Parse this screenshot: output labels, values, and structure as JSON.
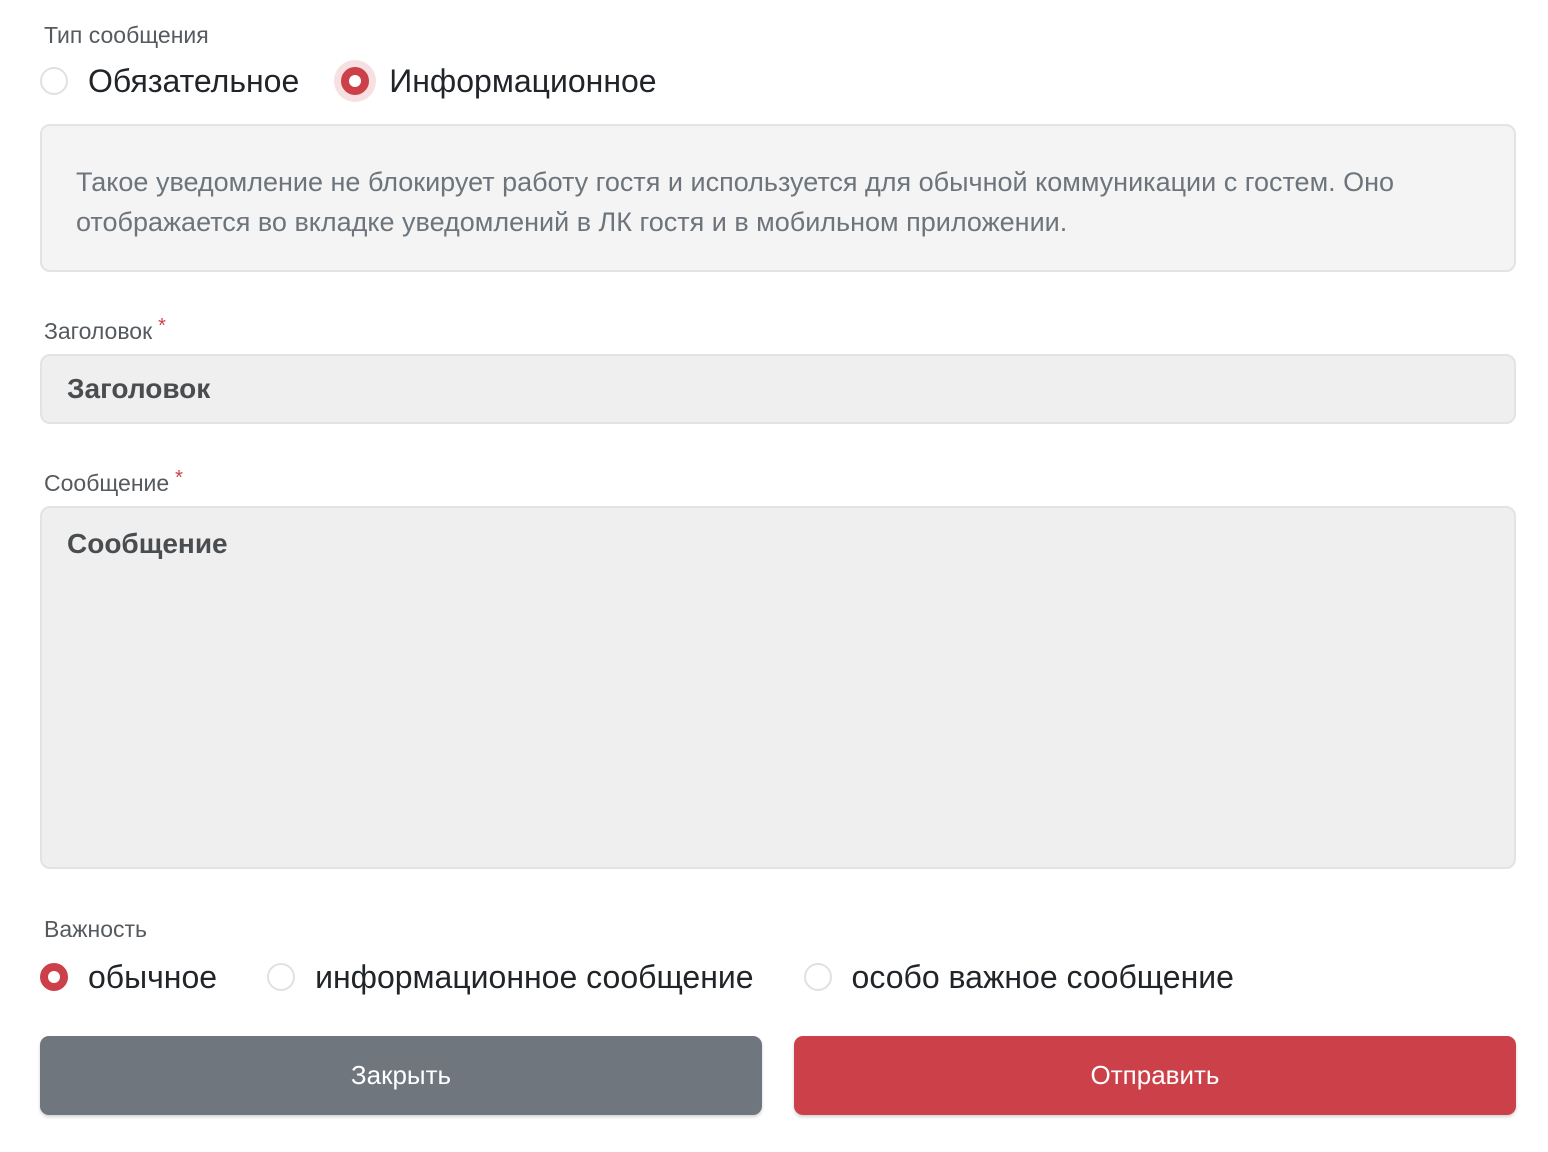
{
  "message_type": {
    "label": "Тип сообщения",
    "options": [
      {
        "label": "Обязательное",
        "selected": false
      },
      {
        "label": "Информационное",
        "selected": true
      }
    ],
    "description": "Такое уведомление не блокирует работу гостя и используется для обычной коммуникации с гостем. Оно отображается во вкладке уведомлений в ЛК гостя и в мобильном приложении."
  },
  "title_field": {
    "label": "Заголовок",
    "required_mark": "*",
    "placeholder": "Заголовок",
    "value": ""
  },
  "message_field": {
    "label": "Сообщение",
    "required_mark": "*",
    "placeholder": "Сообщение",
    "value": ""
  },
  "importance": {
    "label": "Важность",
    "options": [
      {
        "label": "обычное",
        "selected": true
      },
      {
        "label": "информационное сообщение",
        "selected": false
      },
      {
        "label": "особо важное сообщение",
        "selected": false
      }
    ]
  },
  "buttons": {
    "close_label": "Закрыть",
    "send_label": "Отправить"
  },
  "colors": {
    "accent": "#cc4149",
    "close_button": "#6f767e",
    "field_background": "#efefef",
    "info_background": "#f4f4f4"
  }
}
